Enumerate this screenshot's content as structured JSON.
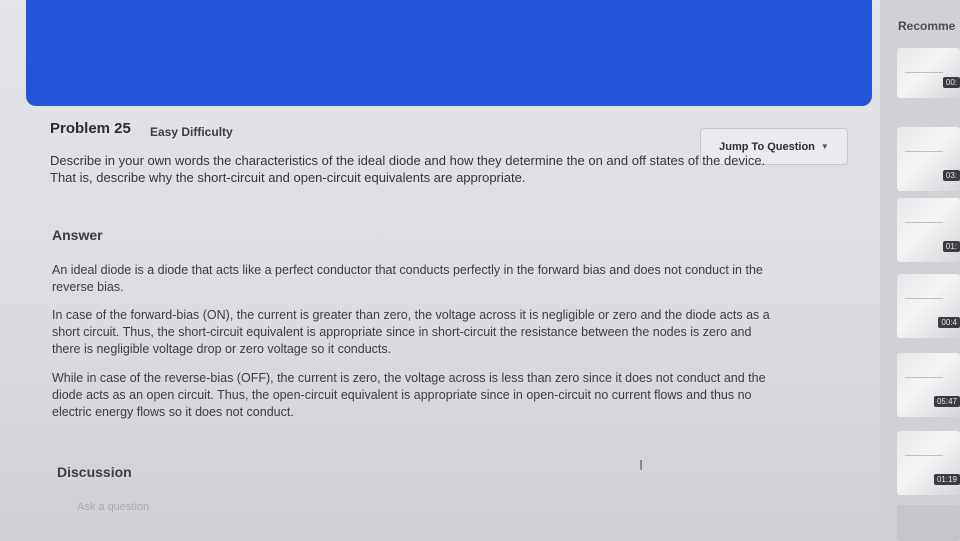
{
  "problem": {
    "title": "Problem 25",
    "difficulty": "Easy Difficulty",
    "jump_label": "Jump To Question",
    "question": "Describe in your own words the characteristics of the ideal diode and how they determine the on and off states of the device. That is, describe why the short-circuit and open-circuit equivalents are appropriate."
  },
  "answer": {
    "heading": "Answer",
    "paragraphs": [
      "An ideal diode is a diode that acts like a perfect conductor that conducts perfectly in the forward bias and does not conduct in the reverse bias.",
      "In case of the forward-bias (ON), the current is greater than zero, the voltage across it is negligible or zero and the diode acts as a short circuit. Thus, the short-circuit equivalent is appropriate since in short-circuit the resistance between the nodes is zero and there is negligible voltage drop or zero voltage so it conducts.",
      "While in case of the reverse-bias (OFF), the current is zero, the voltage across is less than zero since it does not conduct and the diode acts as an open circuit. Thus, the open-circuit equivalent is appropriate since in open-circuit no current flows and thus no electric energy flows so it does not conduct."
    ]
  },
  "discussion": {
    "heading": "Discussion",
    "placeholder": "Ask a question"
  },
  "sidebar": {
    "title": "Recomme",
    "videos": [
      {
        "duration": "00:"
      },
      {
        "duration": "03:"
      },
      {
        "duration": "01:"
      },
      {
        "duration": "00:4"
      },
      {
        "duration": "05:47"
      },
      {
        "duration": "01:19"
      }
    ]
  },
  "colors": {
    "banner": "#2455d6",
    "background": "#dcdde0"
  }
}
